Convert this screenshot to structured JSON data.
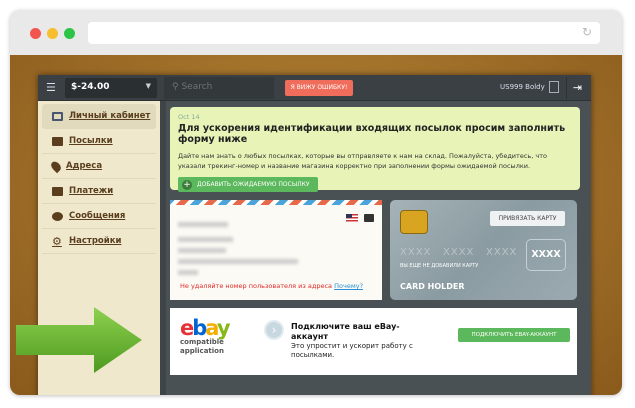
{
  "topbar": {
    "balance": "$-24.00",
    "search_placeholder": "Search",
    "error_button": "Я ВИЖУ ОШИБКУ!",
    "user": "US999 Boldy"
  },
  "sidebar": {
    "items": [
      {
        "label": "Личный кабинет",
        "active": true
      },
      {
        "label": "Посылки"
      },
      {
        "label": "Адреса"
      },
      {
        "label": "Платежи"
      },
      {
        "label": "Сообщения"
      },
      {
        "label": "Настройки"
      }
    ]
  },
  "notice": {
    "date": "Oct 14",
    "title": "Для ускорения идентификации входящих посылок просим заполнить форму ниже",
    "text": "Дайте нам знать о любых посылках, которые вы отправляете к нам на склад. Пожалуйста, убедитесь, что указали трекинг-номер и название магазина корректно при заполнении формы ожидаемой посылки.",
    "button": "ДОБАВИТЬ ОЖИДАЕМУЮ ПОСЫЛКУ"
  },
  "address": {
    "warning": "Не удаляйте номер пользователя из адреса",
    "why_link": "Почему?"
  },
  "card": {
    "bind_button": "ПРИВЯЗАТЬ КАРТУ",
    "groups": [
      "XXXX",
      "XXXX",
      "XXXX",
      "XXXX"
    ],
    "no_card": "ВЫ ЕЩЕ НЕ ДОБАВИЛИ КАРТУ",
    "holder": "CARD HOLDER"
  },
  "ebay": {
    "logo_compatible": "compatible",
    "logo_application": "application",
    "title": "Подключите ваш eBay-аккаунт",
    "text": "Это упростит и ускорит работу с посылками.",
    "button": "ПОДКЛЮЧИТЬ EBAY-АККАУНТ"
  }
}
